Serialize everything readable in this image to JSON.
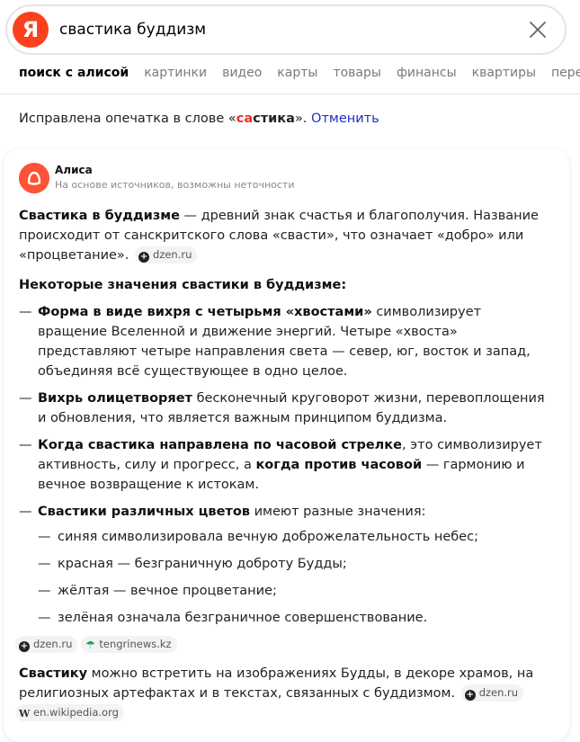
{
  "search": {
    "logo_letter": "Я",
    "query": "свастика буддизм"
  },
  "tabs": [
    {
      "label": "поиск с алисой",
      "active": true
    },
    {
      "label": "картинки"
    },
    {
      "label": "видео"
    },
    {
      "label": "карты"
    },
    {
      "label": "товары"
    },
    {
      "label": "финансы"
    },
    {
      "label": "квартиры"
    },
    {
      "label": "перево"
    }
  ],
  "correction": {
    "prefix": "Исправлена опечатка в слове «",
    "word_highlight": "са",
    "word_rest": "стика",
    "suffix": "». ",
    "undo_label": "Отменить"
  },
  "alice": {
    "name": "Алиса",
    "subtitle": "На основе источников, возможны неточности"
  },
  "answer": {
    "intro_bold": "Свастика в буддизме",
    "intro_text": " — древний знак счастья и благополучия. Название происходит от санскритского слова «свасти», что означает «добро» или «процветание».",
    "intro_source": "dzen.ru",
    "heading": "Некоторые значения свастики в буддизме:",
    "items": [
      {
        "bold": "Форма в виде вихря с четырьмя «хвостами»",
        "text": " символизирует вращение Вселенной и движение энергий. Четыре «хвоста» представляют четыре направления света — север, юг, восток и запад, объединяя всё существующее в одно целое."
      },
      {
        "bold": "Вихрь олицетворяет",
        "text": " бесконечный круговорот жизни, перевоплощения и обновления, что является важным принципом буддизма."
      },
      {
        "bold": "Когда свастика направлена по часовой стрелке",
        "text": ", это символизирует активность, силу и прогресс, а ",
        "bold2": "когда против часовой",
        "text2": " — гармонию и вечное возвращение к истокам."
      },
      {
        "bold": "Свастики различных цветов",
        "text": " имеют разные значения:"
      }
    ],
    "colors": [
      "синяя символизировала вечную доброжелательность небес;",
      "красная — безграничную доброту Будды;",
      "жёлтая — вечное процветание;",
      "зелёная означала безграничное совершенствование."
    ],
    "sources_row": [
      "dzen.ru",
      "tengrinews.kz"
    ],
    "outro_bold": "Свастику",
    "outro_text": " можно встретить на изображениях Будды, в декоре храмов, на религиозных артефактах и в текстах, связанных с буддизмом.",
    "outro_source": "dzen.ru",
    "outro_source2": "en.wikipedia.org"
  },
  "colors": {
    "brand": "#fc3f1d",
    "alice": "#ff5236",
    "link": "#1a2fc7",
    "highlight": "#e8302a"
  },
  "icons": {
    "logo": "yandex-logo",
    "clear": "close-icon",
    "avatar": "alice-avatar",
    "dzen": "dzen-icon",
    "tengri": "tengrinews-icon",
    "wiki": "wikipedia-icon"
  }
}
